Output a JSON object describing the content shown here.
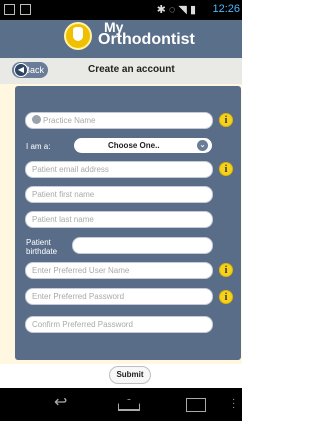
{
  "status_bar": {
    "time": "12:26"
  },
  "header": {
    "brand_line1": "My",
    "brand_line2": "Orthodontist"
  },
  "nav": {
    "back_label": "Back",
    "title": "Create an account"
  },
  "form": {
    "practice_name_placeholder": "Practice Name",
    "i_am_a_label": "I am a:",
    "i_am_a_value": "Choose One..",
    "patient_email_placeholder": "Patient email address",
    "patient_first_placeholder": "Patient first name",
    "patient_last_placeholder": "Patient last name",
    "birthdate_label_1": "Patient",
    "birthdate_label_2": "birthdate",
    "username_placeholder": "Enter Preferred User Name",
    "password_placeholder": "Enter Preferred Password",
    "confirm_password_placeholder": "Confirm Preferred Password",
    "submit_label": "Submit"
  },
  "icons": {
    "info": "i",
    "chevron": "⌄",
    "back_arrow": "↩"
  }
}
